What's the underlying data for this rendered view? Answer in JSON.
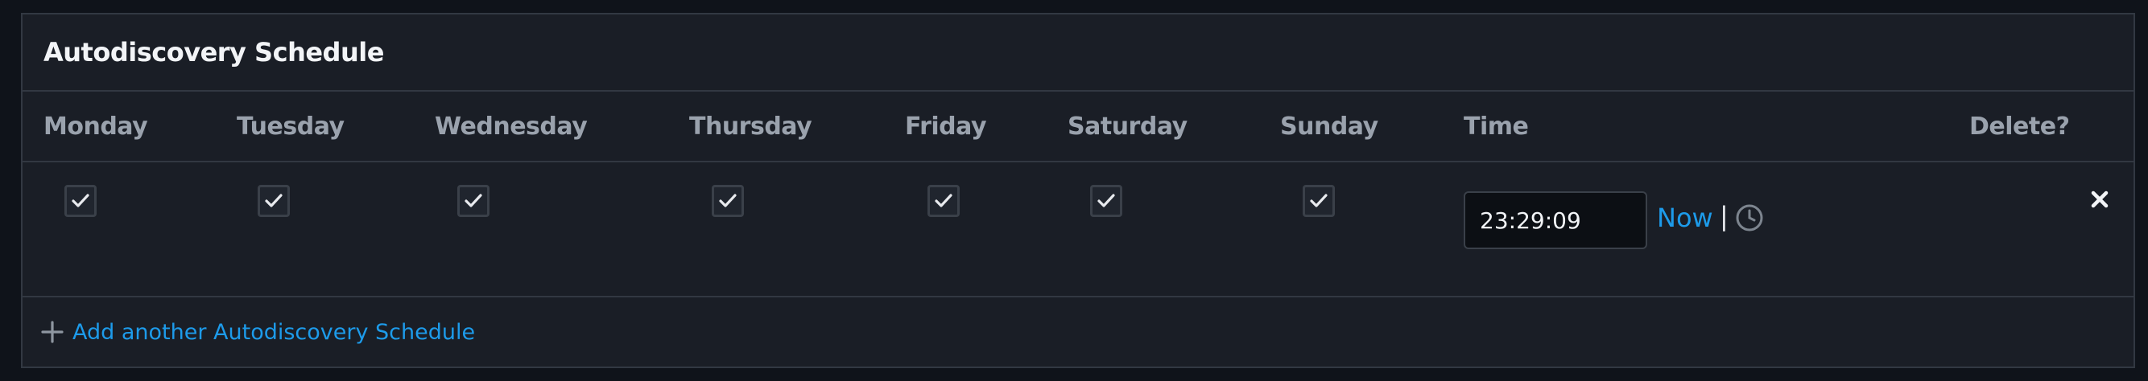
{
  "panel": {
    "title": "Autodiscovery Schedule"
  },
  "columns": [
    "Monday",
    "Tuesday",
    "Wednesday",
    "Thursday",
    "Friday",
    "Saturday",
    "Sunday",
    "Time",
    "Delete?"
  ],
  "schedule_rows": [
    {
      "monday": true,
      "tuesday": true,
      "wednesday": true,
      "thursday": true,
      "friday": true,
      "saturday": true,
      "sunday": true,
      "time": "23:29:09",
      "now_label": "Now",
      "separator": "|"
    }
  ],
  "footer": {
    "add_label": "Add another Autodiscovery Schedule"
  },
  "icons": {
    "checkmark": "check-icon",
    "clock": "clock-icon",
    "delete": "close-icon",
    "add": "plus-icon"
  },
  "colors": {
    "background": "#0f131a",
    "panel": "#1a1e26",
    "border": "#323842",
    "link": "#1d9bea",
    "header_text": "#9aa2ad",
    "title_text": "#f2f4f7"
  }
}
